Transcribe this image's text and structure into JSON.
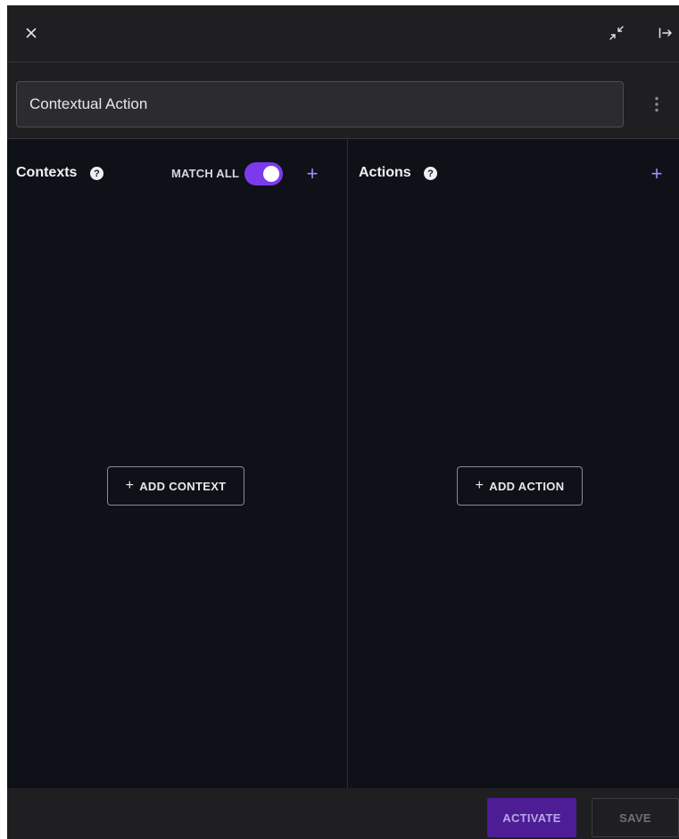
{
  "header": {
    "close_icon": "close-icon",
    "collapse_icon": "collapse-icon",
    "dock_icon": "dock-right-icon"
  },
  "name_row": {
    "name_value": "Contextual Action",
    "menu_icon": "kebab-menu-icon"
  },
  "contexts": {
    "title": "Contexts",
    "help_glyph": "?",
    "match_all_label": "MATCH ALL",
    "match_all_enabled": true,
    "add_icon_glyph": "+",
    "add_button_label": "ADD CONTEXT"
  },
  "actions": {
    "title": "Actions",
    "help_glyph": "?",
    "add_icon_glyph": "+",
    "add_button_label": "ADD ACTION"
  },
  "footer": {
    "activate_label": "ACTIVATE",
    "save_label": "SAVE"
  },
  "colors": {
    "accent": "#7c3aed",
    "accent_light": "#a78bfa",
    "activate_bg": "#4c1d95",
    "panel_bg": "#0f1118",
    "bar_bg": "#1f1f21"
  }
}
